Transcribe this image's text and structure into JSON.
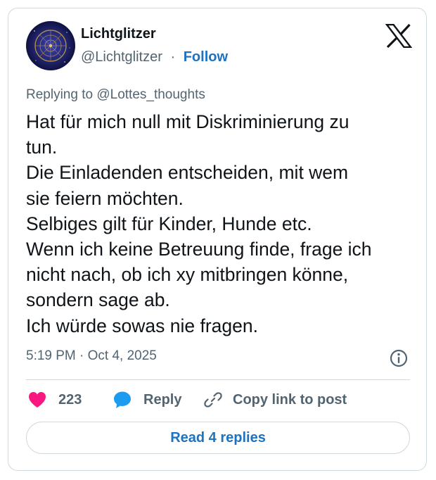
{
  "author": {
    "display_name": "Lichtglitzer",
    "handle": "@Lichtglitzer",
    "separator": "·",
    "follow_label": "Follow",
    "avatar_icon": "starry-clock-avatar"
  },
  "logo_icon": "x-logo-icon",
  "reply_context": {
    "prefix": "Replying to",
    "mention": "@Lottes_thoughts"
  },
  "tweet": {
    "lines": [
      "Hat für mich null mit Diskriminierung zu",
      "tun.",
      "Die Einladenden entscheiden, mit wem",
      "sie feiern möchten.",
      "Selbiges gilt für Kinder, Hunde etc.",
      "Wenn ich keine Betreuung finde, frage ich",
      "nicht nach, ob ich xy mitbringen könne,",
      "sondern sage ab.",
      "Ich würde sowas nie fragen."
    ]
  },
  "timestamp": "5:19 PM · Oct 4, 2025",
  "actions": {
    "like_count": "223",
    "reply_label": "Reply",
    "copy_link_label": "Copy link to post"
  },
  "read_replies_label": "Read 4 replies",
  "colors": {
    "like": "#f91880",
    "reply": "#1d9bf0",
    "link": "#1d72c2",
    "muted": "#536471",
    "border": "#cfd9de"
  }
}
